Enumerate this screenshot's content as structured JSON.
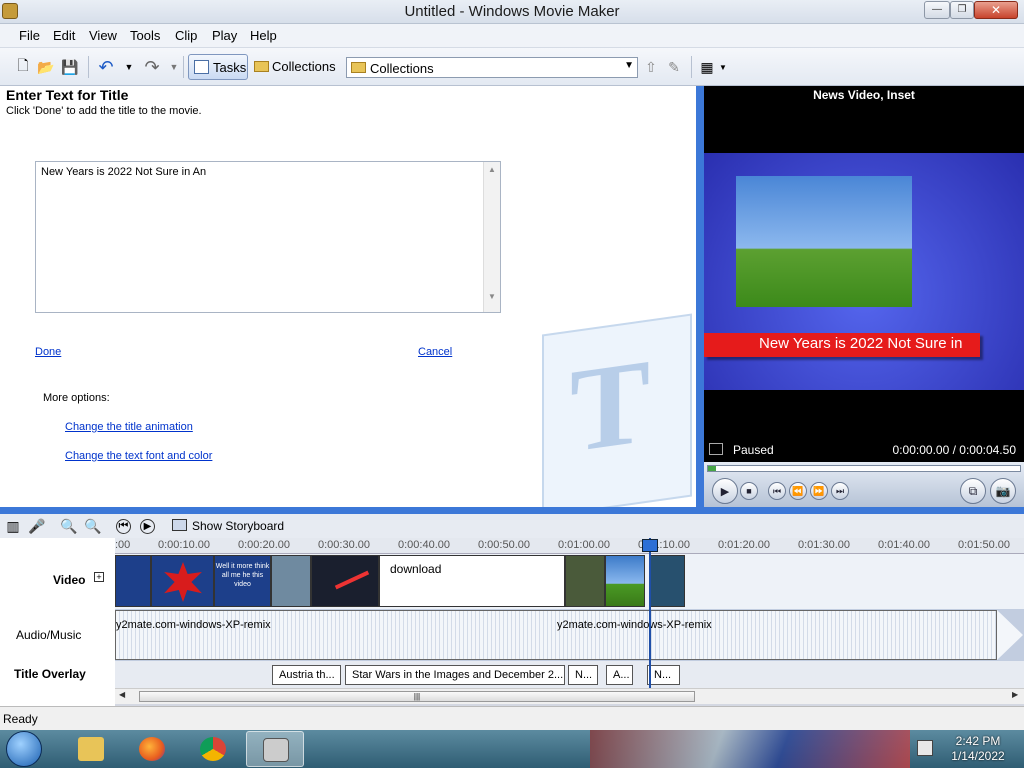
{
  "window": {
    "title": "Untitled - Windows Movie Maker"
  },
  "menu": [
    "File",
    "Edit",
    "View",
    "Tools",
    "Clip",
    "Play",
    "Help"
  ],
  "toolbar": {
    "tasks_label": "Tasks",
    "collections_label": "Collections",
    "collection_select": "Collections"
  },
  "task_pane": {
    "heading": "Enter Text for Title",
    "subheading": "Click 'Done' to add the title to the movie.",
    "title_text": "New Years is 2022 Not Sure in An",
    "done_label": "Done",
    "cancel_label": "Cancel",
    "more_options_label": "More options:",
    "change_animation_label": "Change the title animation",
    "change_font_label": "Change the text font and color"
  },
  "monitor": {
    "title": "News Video, Inset",
    "caption": "New Years is 2022 Not Sure in",
    "status": "Paused",
    "time": "0:00:00.00 / 0:00:04.50",
    "progress": 0.0
  },
  "timeline": {
    "show_storyboard_label": "Show Storyboard",
    "ruler_ticks": [
      ":00",
      "0:00:10.00",
      "0:00:20.00",
      "0:00:30.00",
      "0:00:40.00",
      "0:00:50.00",
      "0:01:00.00",
      "0:01:10.00",
      "0:01:20.00",
      "0:01:30.00",
      "0:01:40.00",
      "0:01:50.00"
    ],
    "playhead_label": "1:10",
    "tracks": {
      "video": "Video",
      "audio": "Audio/Music",
      "overlay": "Title Overlay"
    },
    "video_clips": [
      {
        "label": "",
        "color": "#1d3f8a"
      },
      {
        "label": "",
        "color": "#1d3f8a"
      },
      {
        "label": "Well it more think all me he this video",
        "color": "#1d3f8a"
      },
      {
        "label": "",
        "color": "#6f8aa0"
      },
      {
        "label": "",
        "color": "#1a1f2e"
      },
      {
        "label": "download",
        "color": "#ffffff"
      },
      {
        "label": "",
        "color": "#4a5a3a"
      },
      {
        "label": "",
        "color": "#3d7bc9"
      },
      {
        "label": "",
        "color": "#27506e"
      }
    ],
    "audio_clips": [
      "y2mate.com-windows-XP-remix",
      "y2mate.com-windows-XP-remix"
    ],
    "overlay_clips": [
      "Austria th...",
      "Star Wars in the Images and December 2...",
      "N...",
      "A...",
      "N..."
    ]
  },
  "status_bar": {
    "text": "Ready"
  },
  "taskbar": {
    "time": "2:42 PM",
    "date": "1/14/2022"
  }
}
